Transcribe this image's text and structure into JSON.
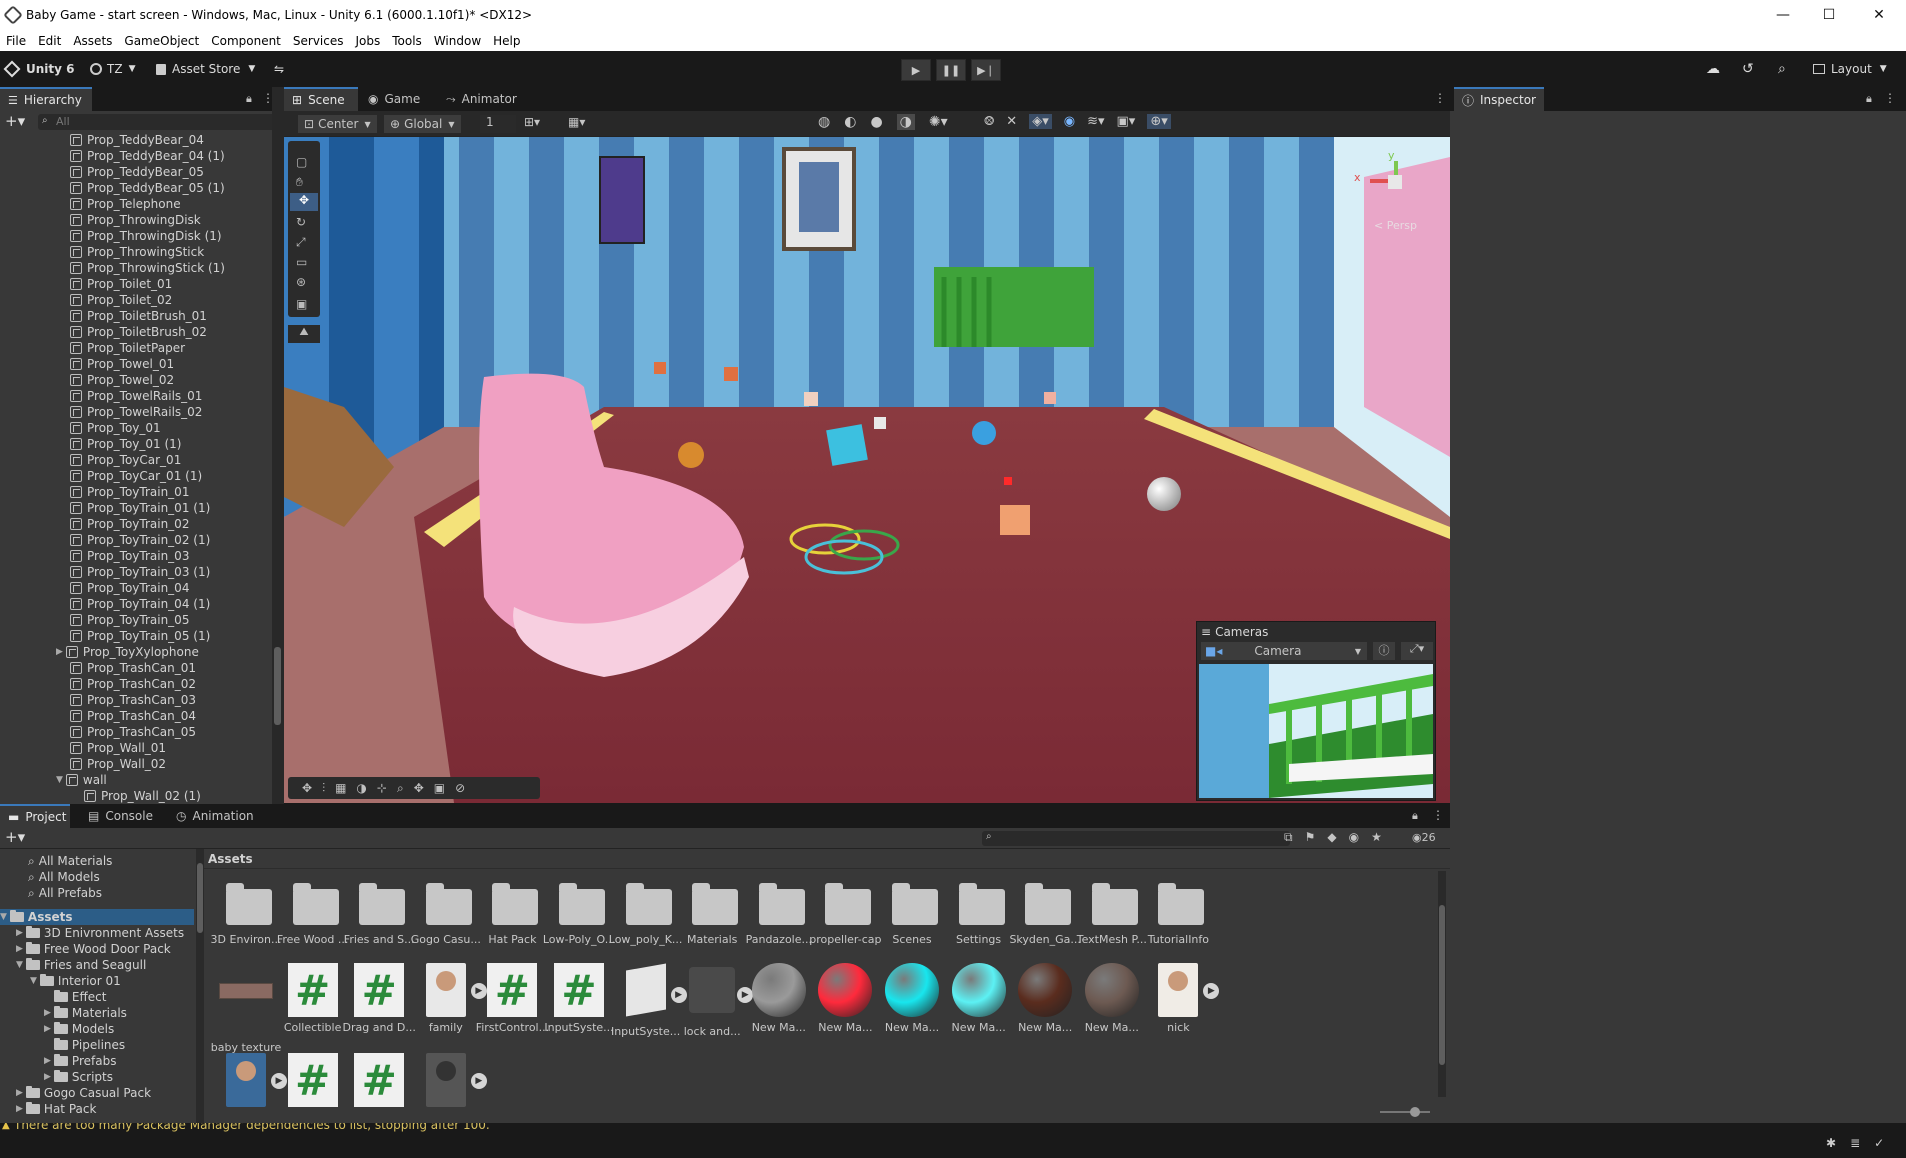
{
  "window": {
    "title": "Baby Game - start screen - Windows, Mac, Linux - Unity 6.1 (6000.1.10f1)* <DX12>",
    "minimize": "—",
    "maximize": "☐",
    "close": "✕"
  },
  "menu": [
    "File",
    "Edit",
    "Assets",
    "GameObject",
    "Component",
    "Services",
    "Jobs",
    "Tools",
    "Window",
    "Help"
  ],
  "toolbar": {
    "unity_label": "Unity 6",
    "account": "TZ",
    "asset_store": "Asset Store",
    "layout": "Layout"
  },
  "hierarchy": {
    "tab": "Hierarchy",
    "search_placeholder": "All",
    "items": [
      "Prop_TeddyBear_04",
      "Prop_TeddyBear_04 (1)",
      "Prop_TeddyBear_05",
      "Prop_TeddyBear_05 (1)",
      "Prop_Telephone",
      "Prop_ThrowingDisk",
      "Prop_ThrowingDisk (1)",
      "Prop_ThrowingStick",
      "Prop_ThrowingStick (1)",
      "Prop_Toilet_01",
      "Prop_Toilet_02",
      "Prop_ToiletBrush_01",
      "Prop_ToiletBrush_02",
      "Prop_ToiletPaper",
      "Prop_Towel_01",
      "Prop_Towel_02",
      "Prop_TowelRails_01",
      "Prop_TowelRails_02",
      "Prop_Toy_01",
      "Prop_Toy_01 (1)",
      "Prop_ToyCar_01",
      "Prop_ToyCar_01 (1)",
      "Prop_ToyTrain_01",
      "Prop_ToyTrain_01 (1)",
      "Prop_ToyTrain_02",
      "Prop_ToyTrain_02 (1)",
      "Prop_ToyTrain_03",
      "Prop_ToyTrain_03 (1)",
      "Prop_ToyTrain_04",
      "Prop_ToyTrain_04 (1)",
      "Prop_ToyTrain_05",
      "Prop_ToyTrain_05 (1)",
      "Prop_ToyXylophone",
      "Prop_TrashCan_01",
      "Prop_TrashCan_02",
      "Prop_TrashCan_03",
      "Prop_TrashCan_04",
      "Prop_TrashCan_05",
      "Prop_Wall_01",
      "Prop_Wall_02",
      "wall",
      "Prop_Wall_02 (1)"
    ]
  },
  "scene_tabs": {
    "scene": "Scene",
    "game": "Game",
    "animator": "Animator"
  },
  "scene_toolbar": {
    "pivot": "Center",
    "space": "Global",
    "grid_value": "1"
  },
  "gizmo": {
    "y": "y",
    "x": "x",
    "persp": "< Persp"
  },
  "cameras_overlay": {
    "title": "Cameras",
    "camera": "Camera"
  },
  "inspector": {
    "tab": "Inspector"
  },
  "bottom_tabs": {
    "project": "Project",
    "console": "Console",
    "animation": "Animation"
  },
  "project": {
    "count": "26",
    "favorites": [
      "All Materials",
      "All Models",
      "All Prefabs"
    ],
    "tree": [
      {
        "label": "Assets",
        "indent": 0,
        "bold": true
      },
      {
        "label": "3D Enivronment Assets",
        "indent": 1
      },
      {
        "label": "Free Wood Door Pack",
        "indent": 1
      },
      {
        "label": "Fries and Seagull",
        "indent": 1
      },
      {
        "label": "Interior 01",
        "indent": 2
      },
      {
        "label": "Effect",
        "indent": 3
      },
      {
        "label": "Materials",
        "indent": 3
      },
      {
        "label": "Models",
        "indent": 3
      },
      {
        "label": "Pipelines",
        "indent": 3
      },
      {
        "label": "Prefabs",
        "indent": 3
      },
      {
        "label": "Scripts",
        "indent": 3
      },
      {
        "label": "Gogo Casual Pack",
        "indent": 1
      },
      {
        "label": "Hat Pack",
        "indent": 1
      }
    ],
    "breadcrumb": "Assets",
    "folders": [
      "3D Environ...",
      "Free Wood ...",
      "Fries and S...",
      "Gogo Casu...",
      "Hat Pack",
      "Low-Poly_O...",
      "Low_poly_K...",
      "Materials",
      "Pandazole...",
      "propeller-cap",
      "Scenes",
      "Settings",
      "Skyden_Ga...",
      "TextMesh P...",
      "TutorialInfo"
    ],
    "row2": [
      {
        "label": "baby texture",
        "kind": "texture"
      },
      {
        "label": "Collectible",
        "kind": "script"
      },
      {
        "label": "Drag and D...",
        "kind": "script"
      },
      {
        "label": "family",
        "kind": "photo"
      },
      {
        "label": "FirstControl...",
        "kind": "script"
      },
      {
        "label": "InputSyste...",
        "kind": "script"
      },
      {
        "label": "InputSyste...",
        "kind": "inputsys"
      },
      {
        "label": "lock and...",
        "kind": "model"
      },
      {
        "label": "New Ma...",
        "kind": "sphere",
        "color": "#9a9a9a"
      },
      {
        "label": "New Ma...",
        "kind": "sphere",
        "color": "#ff2a3c"
      },
      {
        "label": "New Ma...",
        "kind": "sphere",
        "color": "#18e6ee"
      },
      {
        "label": "New Ma...",
        "kind": "sphere",
        "color": "#5cf1f4"
      },
      {
        "label": "New Ma...",
        "kind": "sphere",
        "color": "#5a2c1e"
      },
      {
        "label": "New Ma...",
        "kind": "sphere",
        "color": "#6d5a52"
      },
      {
        "label": "nick",
        "kind": "face"
      }
    ],
    "row3": [
      {
        "label": "",
        "kind": "face2"
      },
      {
        "label": "",
        "kind": "script"
      },
      {
        "label": "",
        "kind": "script"
      },
      {
        "label": "",
        "kind": "figure"
      }
    ]
  },
  "status": {
    "message": "There are too many Package Manager dependencies to list, stopping after 100."
  },
  "colors": {
    "accent": "#3a79bb",
    "panel": "#383838",
    "dark": "#191919"
  }
}
